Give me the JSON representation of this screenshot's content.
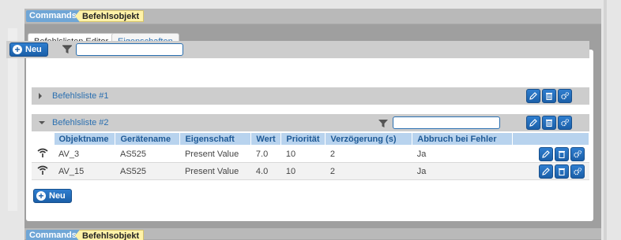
{
  "breadcrumb": {
    "commands": "Commands",
    "object": "Befehlsobjekt"
  },
  "tabs": [
    {
      "label": "Befehlslisten Editor",
      "active": true
    },
    {
      "label": "Eigenschaften",
      "active": false
    }
  ],
  "toolbar": {
    "new_label": "Neu",
    "filter_value": ""
  },
  "groups": [
    {
      "label": "Befehlsliste #1",
      "expanded": false
    },
    {
      "label": "Befehlsliste #2",
      "expanded": true,
      "filter_value": ""
    }
  ],
  "table": {
    "headers": [
      "Objektname",
      "Gerätename",
      "Eigenschaft",
      "Wert",
      "Priorität",
      "Verzögerung (s)",
      "Abbruch bei Fehler"
    ],
    "rows": [
      {
        "objektname": "AV_3",
        "geraetename": "AS525",
        "eigenschaft": "Present Value",
        "wert": "7.0",
        "prioritaet": "10",
        "verzoegerung": "2",
        "abbruch": "Ja"
      },
      {
        "objektname": "AV_15",
        "geraetename": "AS525",
        "eigenschaft": "Present Value",
        "wert": "4.0",
        "prioritaet": "10",
        "verzoegerung": "2",
        "abbruch": "Ja"
      }
    ]
  },
  "group2_new_label": "Neu",
  "colors": {
    "accent": "#1b5fa8",
    "header_bg": "#b8d3ee",
    "crumb_yellow": "#fff2a8"
  },
  "icons": [
    "plus-circle-icon",
    "filter-icon",
    "edit-icon",
    "trash-icon",
    "settings-icon",
    "wireless-signal-icon",
    "arrow-right-icon",
    "arrow-down-icon"
  ]
}
